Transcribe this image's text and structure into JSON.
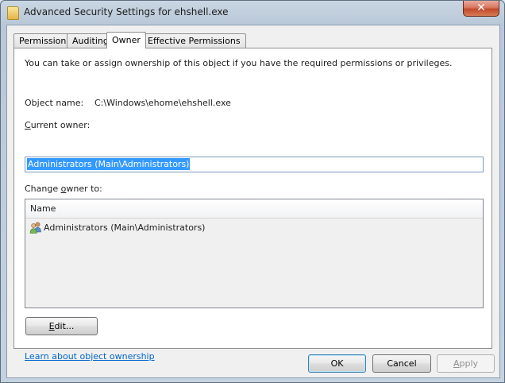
{
  "window": {
    "title": "Advanced Security Settings for ehshell.exe",
    "close_glyph": "✕"
  },
  "tabs": [
    {
      "label": "Permissions",
      "active": false
    },
    {
      "label": "Auditing",
      "active": false
    },
    {
      "label": "Owner",
      "active": true
    },
    {
      "label": "Effective Permissions",
      "active": false
    }
  ],
  "owner_tab": {
    "description": "You can take or assign ownership of this object if you have the required permissions or privileges.",
    "object_name_label": "Object name:",
    "object_name_value": "C:\\Windows\\ehome\\ehshell.exe",
    "current_owner_label_mnemonic": "C",
    "current_owner_label_rest": "urrent owner:",
    "current_owner_value": "Administrators (Main\\Administrators)",
    "change_owner_label_pre": "Change ",
    "change_owner_label_mnemonic": "o",
    "change_owner_label_post": "wner to:",
    "list_header_name": "Name",
    "list_items": [
      {
        "name": "Administrators (Main\\Administrators)",
        "icon": "users-group-icon"
      }
    ],
    "edit_button_mnemonic": "E",
    "edit_button_rest": "dit...",
    "learn_link": "Learn about object ownership"
  },
  "footer": {
    "ok_label": "OK",
    "cancel_label": "Cancel",
    "apply_label_mnemonic": "A",
    "apply_label_rest": "pply"
  },
  "colors": {
    "selection": "#3399ff",
    "link": "#0066cc",
    "close_button": "#c24a2c"
  }
}
